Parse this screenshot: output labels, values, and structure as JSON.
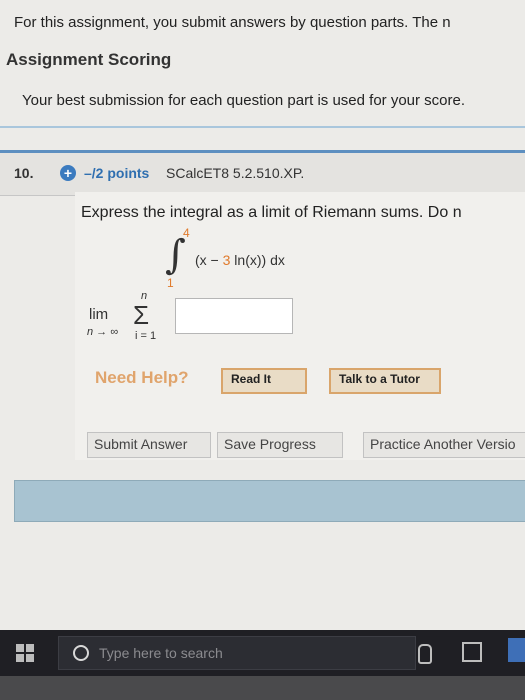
{
  "intro_text": "For this assignment, you submit answers by question parts. The n",
  "scoring": {
    "heading": "Assignment Scoring",
    "text": "Your best submission for each question part is used for your score."
  },
  "question": {
    "number": "10.",
    "points": "–/2 points",
    "course_code": "SCalcET8 5.2.510.XP.",
    "prompt": "Express the integral as a limit of Riemann sums. Do n",
    "integral": {
      "upper": "4",
      "lower": "1",
      "integrand_prefix": "(x − ",
      "integrand_coef": "3",
      "integrand_suffix": " ln(x)) dx"
    },
    "limit": {
      "lim": "lim",
      "sub": "n → ∞",
      "sum_top": "n",
      "sum_bottom": "i = 1"
    },
    "answer_value": ""
  },
  "help": {
    "label": "Need Help?",
    "read_it": "Read It",
    "tutor": "Talk to a Tutor"
  },
  "actions": {
    "submit": "Submit Answer",
    "save": "Save Progress",
    "practice": "Practice Another Versio"
  },
  "taskbar": {
    "search_placeholder": "Type here to search"
  },
  "colors": {
    "accent_blue": "#2f6fb0",
    "header_border": "#5d8fc0",
    "help_orange": "#e0a46c",
    "limit_orange": "#e07a2c",
    "taskbar": "#1f1f24"
  }
}
